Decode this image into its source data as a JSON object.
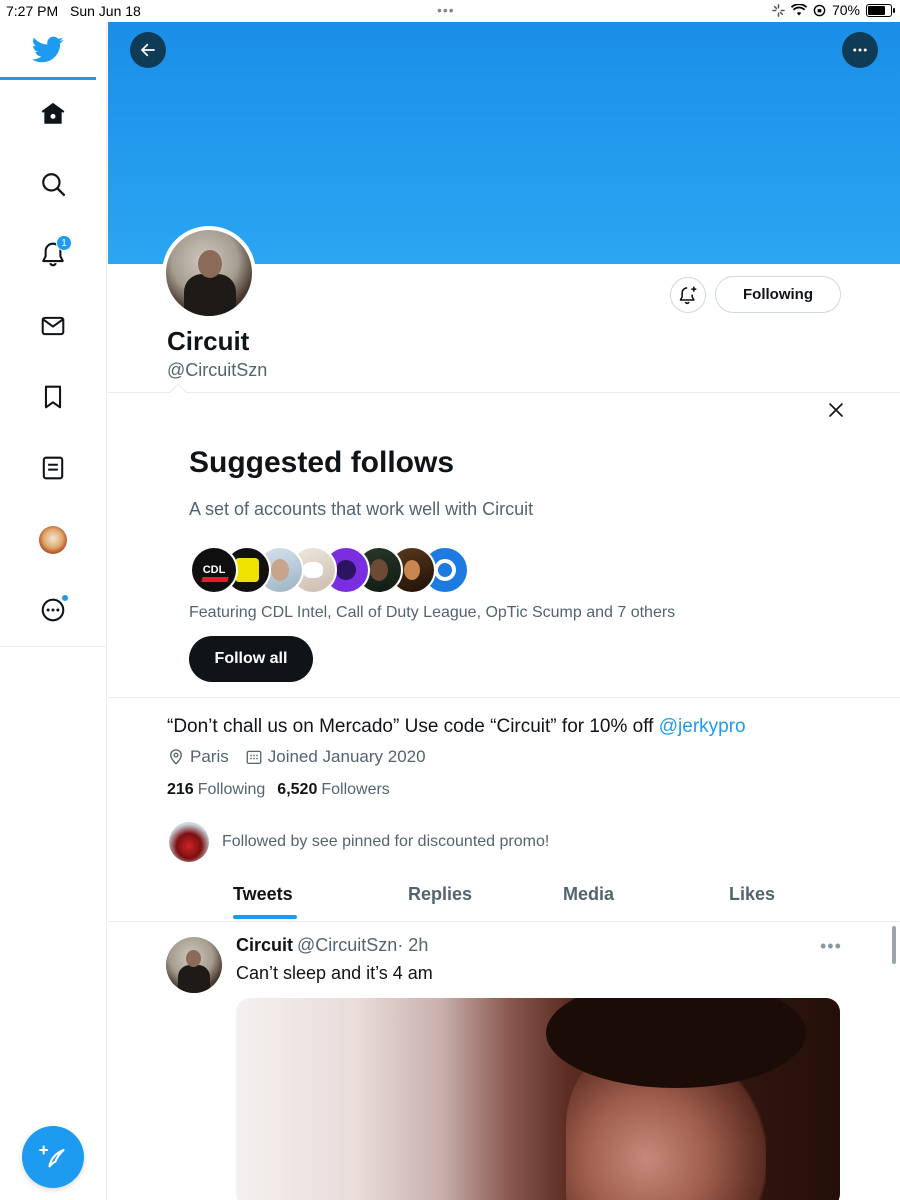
{
  "status_bar": {
    "time": "7:27 PM",
    "date": "Sun Jun 18",
    "battery": "70%",
    "battery_level": 0.7
  },
  "sidebar": {
    "notification_count": "1",
    "items": [
      "twitter-logo",
      "home-icon",
      "search-icon",
      "bell-icon",
      "mail-icon",
      "bookmark-icon",
      "lists-icon",
      "profile-avatar",
      "more-icon"
    ]
  },
  "profile": {
    "name": "Circuit",
    "handle": "@CircuitSzn",
    "following_button": "Following",
    "bio_text": "“Don’t chall us on Mercado” Use code “Circuit” for 10% off ",
    "bio_link": "@jerkypro",
    "location": "Paris",
    "joined": "Joined January 2020",
    "following_count": "216",
    "following_label": "Following",
    "followers_count": "6,520",
    "followers_label": "Followers",
    "followed_by": "Followed by see pinned for discounted promo!"
  },
  "suggested": {
    "title": "Suggested follows",
    "subtitle": "A set of accounts that work well with Circuit",
    "featuring": "Featuring CDL Intel, Call of Duty League, OpTic Scump and 7 others",
    "follow_all": "Follow all",
    "avatar_label": "CDL"
  },
  "tabs": [
    "Tweets",
    "Replies",
    "Media",
    "Likes"
  ],
  "tweet": {
    "name": "Circuit",
    "handle": "@CircuitSzn",
    "time": "· 2h",
    "text": "Can’t sleep and it’s 4 am"
  },
  "colors": {
    "accent": "#1d9bf0",
    "banner": "#1d9bf0",
    "text": "#0f1419",
    "muted": "#536471"
  }
}
